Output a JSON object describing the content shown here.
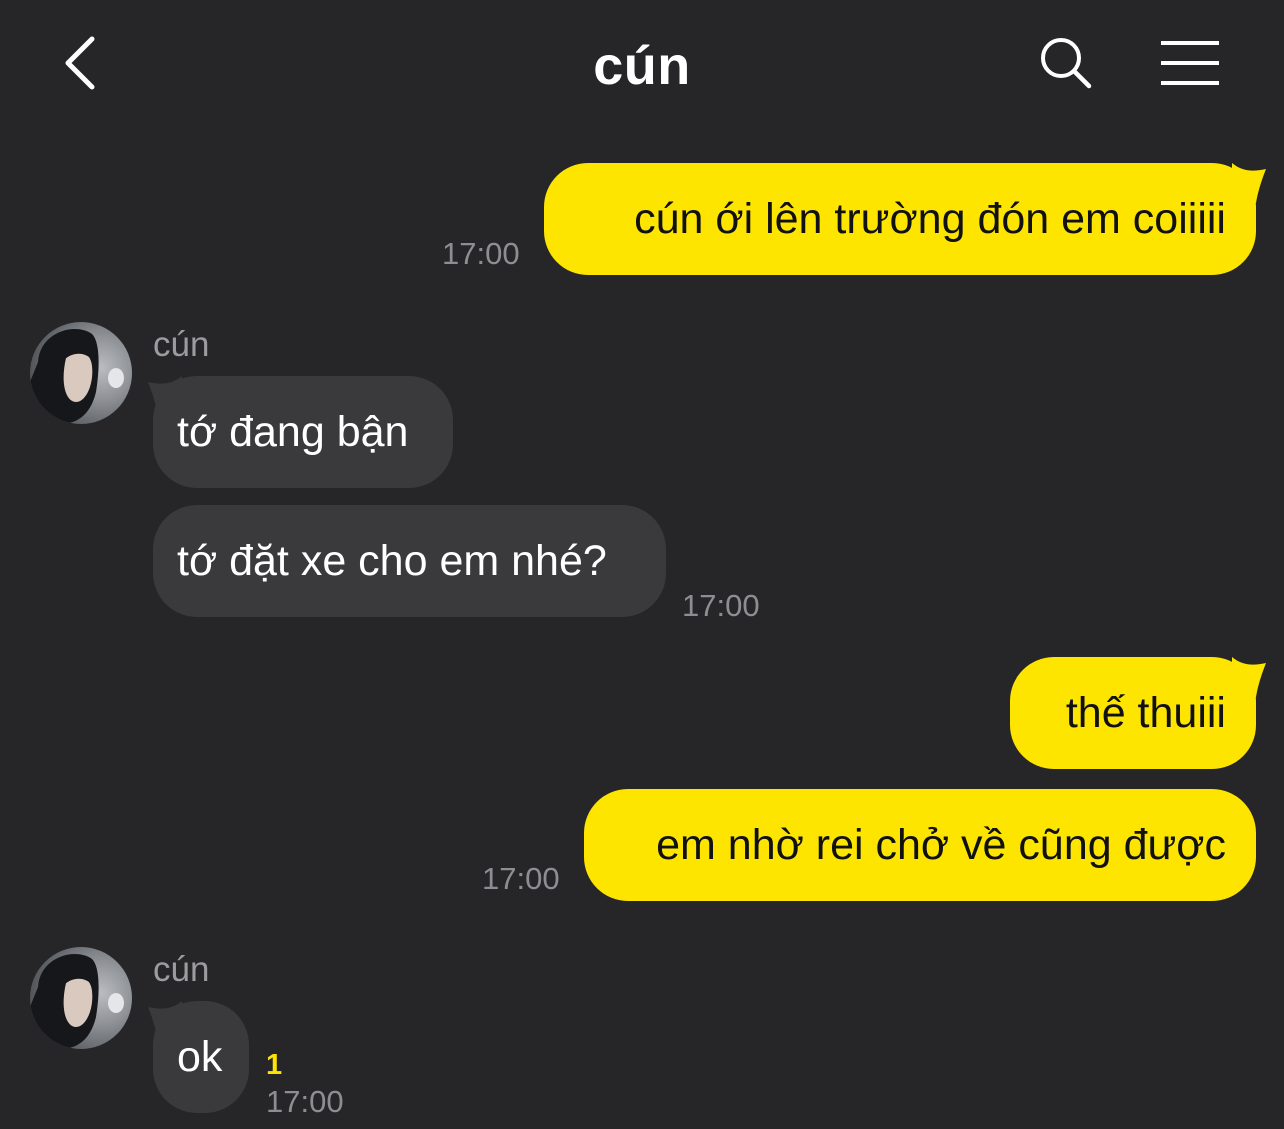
{
  "header": {
    "title": "cún",
    "back_icon": "chevron-left-icon",
    "search_icon": "search-icon",
    "menu_icon": "hamburger-menu-icon"
  },
  "messages": [
    {
      "sender": "me",
      "text": "cún ới lên trường đón em coiiiii",
      "time": "17:00"
    },
    {
      "sender": "cún",
      "text": "tớ đang bận"
    },
    {
      "sender": "cún",
      "text": "tớ đặt xe cho em nhé?",
      "time": "17:00"
    },
    {
      "sender": "me",
      "text": "thế thuiii"
    },
    {
      "sender": "me",
      "text": "em nhờ rei chở về cũng được",
      "time": "17:00"
    },
    {
      "sender": "cún",
      "text": "ok",
      "time": "17:00",
      "unread": "1"
    }
  ],
  "colors": {
    "background": "#262628",
    "outgoing_bubble": "#fee500",
    "incoming_bubble": "#3a3a3c",
    "timestamp": "#8e8e92",
    "unread_count": "#fee500"
  }
}
